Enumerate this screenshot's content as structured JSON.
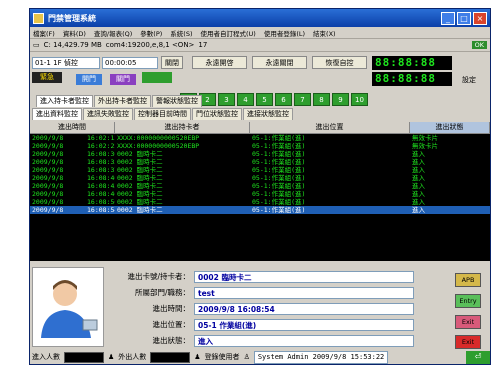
{
  "window": {
    "title": "門禁管理系統"
  },
  "menu": [
    "檔案(F)",
    "資料(D)",
    "查詢/報表(Q)",
    "參數(P)",
    "系統(S)",
    "使用者自訂程式(U)",
    "使用者登錄(L)",
    "結束(X)"
  ],
  "status_line": {
    "disk": "C: 14,429.79 MB",
    "port": "com4:19200,e,8,1 <ON>",
    "count": "17",
    "ok": "OK"
  },
  "controls": {
    "reader_select": "01-1 1F 偵控",
    "time_select": "00:00:05",
    "close_label": "關閉",
    "always_open": "永遠開啓",
    "always_close": "永遠關閉",
    "restore_auto": "恢復自控",
    "emergency": "緊急",
    "open": "開門",
    "close": "關門",
    "numbers": [
      "1",
      "2",
      "3",
      "4",
      "5",
      "6",
      "7",
      "8",
      "9",
      "10"
    ],
    "led_top": "88:88:88",
    "led_bottom": "88:88:88",
    "settings": "設定"
  },
  "tabs_row1": [
    "進入持卡者監控",
    "外出持卡者監控",
    "警報狀態監控"
  ],
  "tabs_row2": [
    "進出資料監控",
    "進訊失敗監控",
    "控制器目前時間",
    "門位狀態監控",
    "進接狀態監控"
  ],
  "grid": {
    "headers": [
      "進出時間",
      "進出持卡者",
      "進出位置",
      "進出狀態"
    ],
    "rows": [
      [
        "2009/9/8",
        "16:02:12",
        "XXXX:0000000000520EBP",
        "05-1:作業組(進)",
        "無效卡片"
      ],
      [
        "2009/9/8",
        "16:02:22",
        "XXXX:0000000000520EBP",
        "05-1:作業組(進)",
        "無效卡片"
      ],
      [
        "2009/9/8",
        "16:08:30",
        "0002 臨時卡二",
        "05-1:作業組(進)",
        "進入"
      ],
      [
        "2009/9/8",
        "16:08:33",
        "0002 臨時卡二",
        "05-1:作業組(進)",
        "進入"
      ],
      [
        "2009/9/8",
        "16:08:37",
        "0002 臨時卡二",
        "05-1:作業組(進)",
        "進入"
      ],
      [
        "2009/9/8",
        "16:08:40",
        "0002 臨時卡二",
        "05-1:作業組(進)",
        "進入"
      ],
      [
        "2009/9/8",
        "16:08:43",
        "0002 臨時卡二",
        "05-1:作業組(進)",
        "進入"
      ],
      [
        "2009/9/8",
        "16:08:46",
        "0002 臨時卡二",
        "05-1:作業組(進)",
        "進入"
      ],
      [
        "2009/9/8",
        "16:08:50",
        "0002 臨時卡二",
        "05-1:作業組(進)",
        "進入"
      ],
      [
        "2009/9/8",
        "16:08:54",
        "0002 臨時卡二",
        "05-1:作業組(進)",
        "進入"
      ]
    ]
  },
  "detail": {
    "card_label": "進出卡號/持卡者：",
    "card_value": "0002 臨時卡二",
    "dept_label": "所屬部門/職務：",
    "dept_value": "test",
    "time_label": "進出時間：",
    "time_value": "2009/9/8 16:08:54",
    "pos_label": "進出位置：",
    "pos_value": "05-1 作業組(進)",
    "state_label": "進出狀態：",
    "state_value": "進入"
  },
  "side_buttons": [
    "APB",
    "Entry",
    "Exit",
    "Exit"
  ],
  "statusbar": {
    "in_count_label": "進入人數",
    "out_count_label": "外出人數",
    "login_label": "登錄使用者",
    "system_msg": "System Admin 2009/9/8 15:53:22"
  }
}
